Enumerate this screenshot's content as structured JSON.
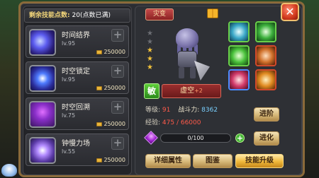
{
  "skill_panel": {
    "points_label": "剩余技能点数:",
    "points_value": "20",
    "points_note": "(点数已满)",
    "skills": [
      {
        "name": "时间结界",
        "level": "lv.95",
        "cost": "250000",
        "icon": "time-barrier-icon"
      },
      {
        "name": "时空锁定",
        "level": "lv.95",
        "cost": "250000",
        "icon": "time-lock-icon"
      },
      {
        "name": "时空回溯",
        "level": "lv.75",
        "cost": "250000",
        "icon": "time-rewind-icon"
      },
      {
        "name": "钟慢力场",
        "level": "lv.55",
        "cost": "250000",
        "icon": "slow-field-icon"
      }
    ],
    "plus_glyph": "+"
  },
  "hero_panel": {
    "tab_label": "灾变",
    "close_glyph": "✕",
    "stars_total": 5,
    "stars_lit": 3,
    "grade": "敏",
    "hero_name": "虚空",
    "hero_plus": "+2",
    "level_label": "等级:",
    "level_value": "91",
    "power_label": "战斗力:",
    "power_value": "8362",
    "exp_label": "经验:",
    "exp_value": "475 / 66000",
    "xp_bar_text": "0/100",
    "xp_fraction": 0.0,
    "buttons": {
      "advance": "进阶",
      "evolve": "进化",
      "detail": "详细属性",
      "guide": "图鉴",
      "upgrade": "技能升级"
    }
  }
}
